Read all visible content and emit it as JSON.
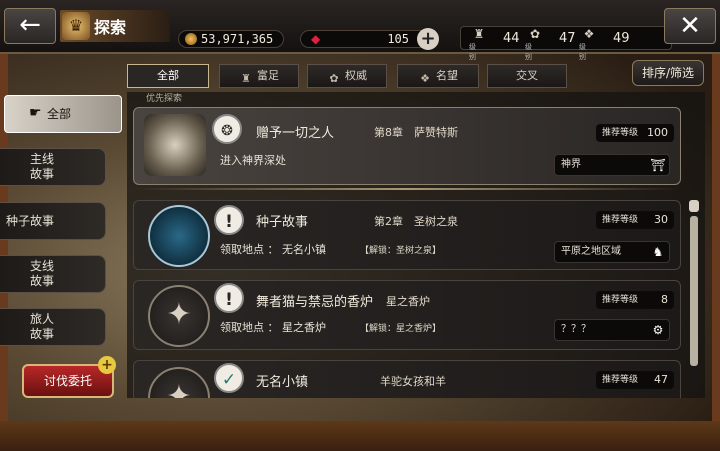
{
  "header": {
    "title": "探索",
    "gold": "53,971,365",
    "gems": "105",
    "levels": [
      {
        "caption": "级别",
        "value": "44"
      },
      {
        "caption": "级别",
        "value": "47"
      },
      {
        "caption": "级别",
        "value": "49"
      }
    ]
  },
  "filters": [
    {
      "label": "全部"
    },
    {
      "label": "富足"
    },
    {
      "label": "权威"
    },
    {
      "label": "名望"
    },
    {
      "label": "交叉"
    }
  ],
  "sort_label": "排序/筛选",
  "sidebar": {
    "items": [
      {
        "label": "全部"
      },
      {
        "label": "主线\n故事"
      },
      {
        "label": "种子故事"
      },
      {
        "label": "支线\n故事"
      },
      {
        "label": "旅人\n故事"
      }
    ],
    "hunt_label": "讨伐委托"
  },
  "section_label": "优先探索",
  "priority_quest": {
    "name": "赠予一切之人",
    "chapter": "第8章　萨赞特斯",
    "subtitle": "进入神界深处",
    "rec_label": "推荐等级",
    "rec_value": "100",
    "region": "神界"
  },
  "quests": [
    {
      "name": "种子故事",
      "chapter": "第2章　圣树之泉",
      "subtitle": "领取地点 ： 无名小镇",
      "unlock": "【解锁：圣树之泉】",
      "rec_label": "推荐等级",
      "rec_value": "30",
      "region": "平原之地区域"
    },
    {
      "name": "舞者猫与禁忌的香炉",
      "chapter": "星之香炉",
      "subtitle": "领取地点 ： 星之香炉",
      "unlock": "【解锁：星之香炉】",
      "rec_label": "推荐等级",
      "rec_value": "8",
      "region": "？？？"
    },
    {
      "name": "无名小镇",
      "chapter": "羊驼女孩和羊",
      "rec_label": "推荐等级",
      "rec_value": "47"
    }
  ],
  "icons": {
    "back": "arrow-left",
    "close": "close",
    "gold": "coin",
    "gem": "ruby",
    "quest_alert": "exclamation",
    "quest_done": "check"
  }
}
